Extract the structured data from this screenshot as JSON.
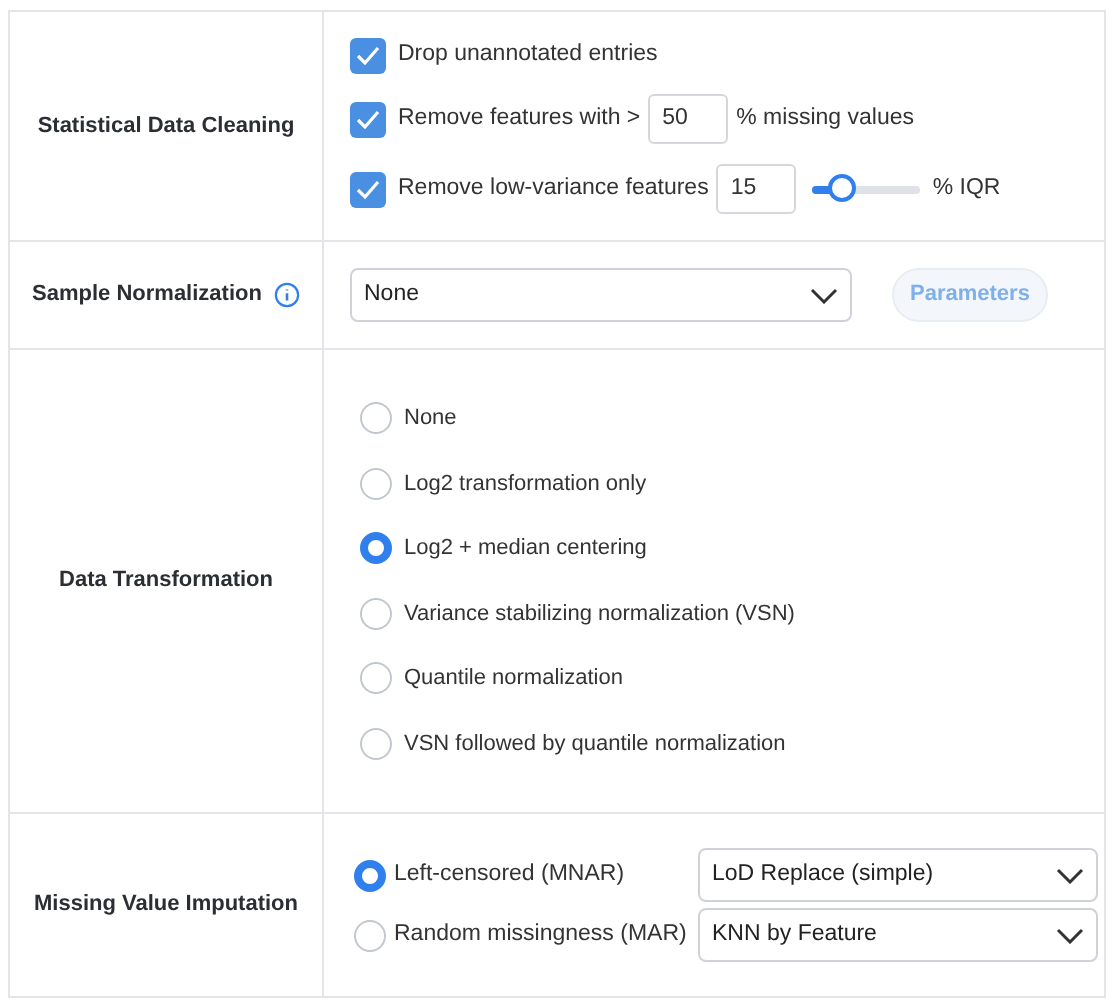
{
  "sections": [
    {
      "kind": "cleaning",
      "label": "Statistical Data Cleaning",
      "options": [
        {
          "kind": "plain",
          "checked": true,
          "label": "Drop unannotated entries"
        },
        {
          "kind": "input",
          "checked": true,
          "label": "Remove features with >",
          "value": "50",
          "suffix": "% missing values"
        },
        {
          "kind": "slider",
          "checked": true,
          "label": "Remove low-variance features",
          "value": "15",
          "level": 0.28,
          "suffix": "% IQR"
        }
      ]
    },
    {
      "kind": "normalization",
      "label": "Sample Normalization",
      "info": true,
      "select": "None",
      "button": {
        "label": "Parameters",
        "disabled": true
      }
    },
    {
      "kind": "transformation",
      "label": "Data Transformation",
      "options": [
        {
          "label": "None",
          "selected": false
        },
        {
          "label": "Log2 transformation only",
          "selected": false
        },
        {
          "label": "Log2 + median centering",
          "selected": true
        },
        {
          "label": "Variance stabilizing normalization (VSN)",
          "selected": false
        },
        {
          "label": "Quantile normalization",
          "selected": false
        },
        {
          "label": "VSN followed by quantile normalization",
          "selected": false
        }
      ]
    },
    {
      "kind": "imputation",
      "label": "Missing Value Imputation",
      "options": [
        {
          "label": "Left-censored (MNAR)",
          "selected": true,
          "select": "LoD Replace (simple)"
        },
        {
          "label": "Random missingness (MAR)",
          "selected": false,
          "select": "KNN by Feature"
        }
      ]
    }
  ]
}
